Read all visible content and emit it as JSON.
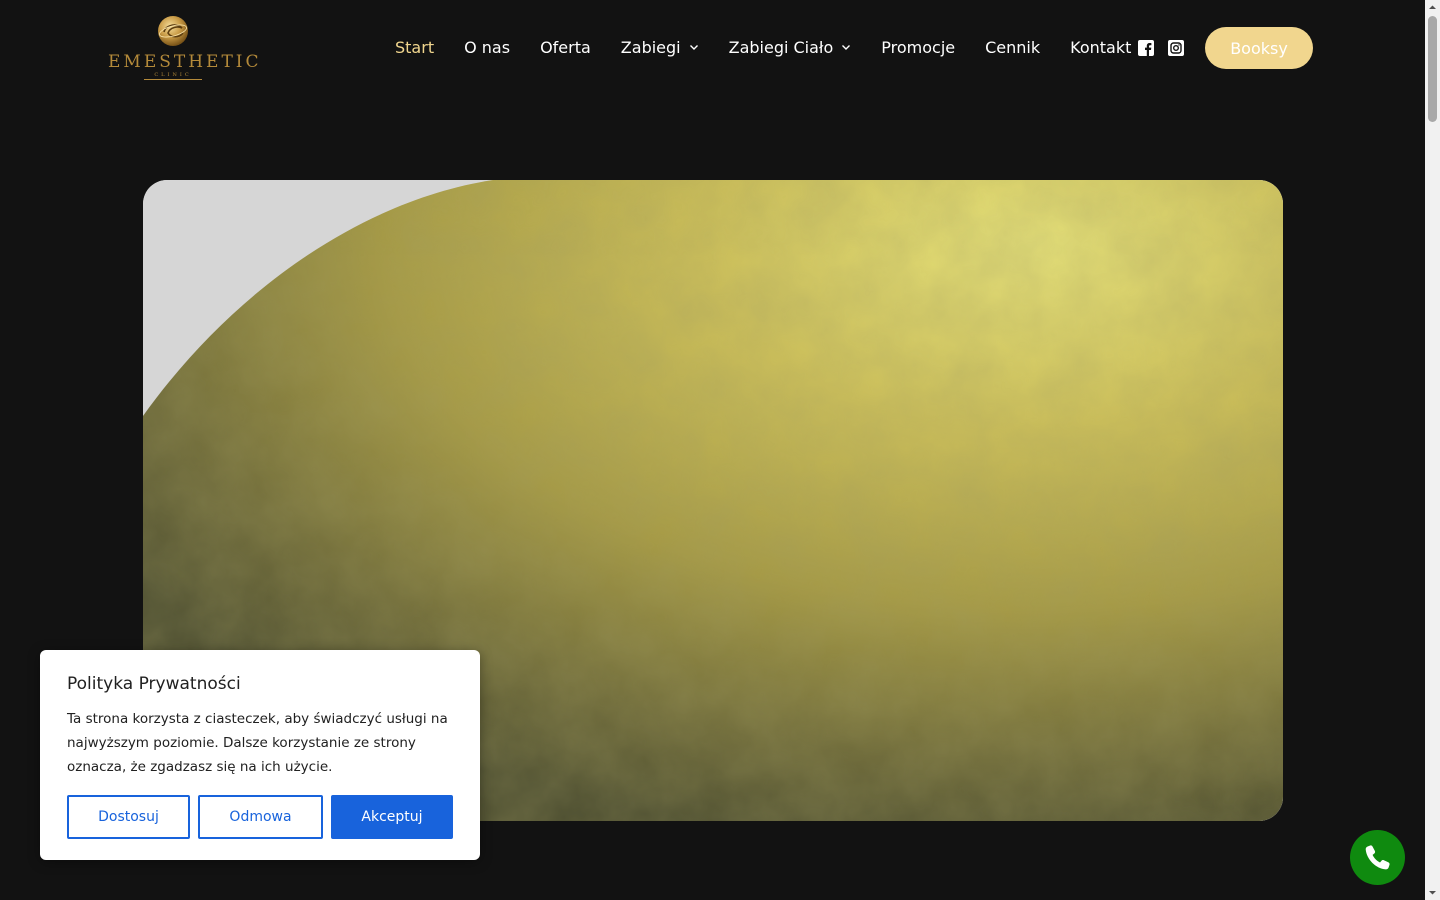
{
  "header": {
    "logo": {
      "emblem_icon": "gold-spiral-emblem",
      "wordmark": "EMESTHETIC",
      "subline": "CLINIC"
    },
    "nav": [
      {
        "label": "Start",
        "active": true,
        "has_dropdown": false
      },
      {
        "label": "O nas",
        "active": false,
        "has_dropdown": false
      },
      {
        "label": "Oferta",
        "active": false,
        "has_dropdown": false
      },
      {
        "label": "Zabiegi",
        "active": false,
        "has_dropdown": true
      },
      {
        "label": "Zabiegi Ciało",
        "active": false,
        "has_dropdown": true
      },
      {
        "label": "Promocje",
        "active": false,
        "has_dropdown": false
      },
      {
        "label": "Cennik",
        "active": false,
        "has_dropdown": false
      },
      {
        "label": "Kontakt",
        "active": false,
        "has_dropdown": false
      }
    ],
    "social": [
      {
        "icon": "facebook-icon"
      },
      {
        "icon": "instagram-icon"
      }
    ],
    "booksy_label": "Booksy"
  },
  "hero": {
    "image_subject": "gold-textured-sphere"
  },
  "cookie_banner": {
    "title": "Polityka Prywatności",
    "text": "Ta strona korzysta z ciasteczek, aby świadczyć usługi na najwyższym poziomie. Dalsze korzystanie ze strony oznacza, że zgadzasz się na ich użycie.",
    "customize_label": "Dostosuj",
    "reject_label": "Odmowa",
    "accept_label": "Akceptuj"
  },
  "call_button": {
    "icon": "phone-icon"
  },
  "colors": {
    "background": "#121212",
    "accent_gold": "#f1d68e",
    "logo_gold": "#b48a3a",
    "cookie_blue": "#1863dc",
    "call_green": "#0f8a0f"
  }
}
